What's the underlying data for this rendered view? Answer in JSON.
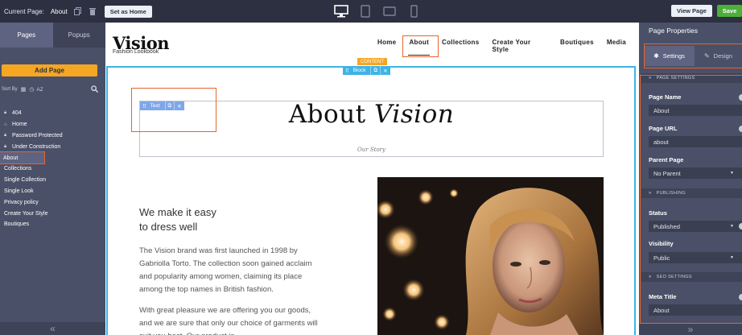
{
  "topbar": {
    "current_page_label": "Current Page:",
    "current_page_value": "About",
    "set_as_home": "Set as Home",
    "view_page": "View Page",
    "save": "Save"
  },
  "left": {
    "tabs": [
      "Pages",
      "Popups"
    ],
    "add_page": "Add Page",
    "sort_by": "Sort By",
    "sort_az": "AZ",
    "pages": [
      {
        "label": "404",
        "icon": "lock-icon"
      },
      {
        "label": "Home",
        "icon": "home-icon"
      },
      {
        "label": "Password Protected",
        "icon": "lock-icon"
      },
      {
        "label": "Under Construction",
        "icon": "lock-icon"
      },
      {
        "label": "About",
        "icon": ""
      },
      {
        "label": "Collections",
        "icon": ""
      },
      {
        "label": "Single Collection",
        "icon": ""
      },
      {
        "label": "Single Look",
        "icon": ""
      },
      {
        "label": "Privacy policy",
        "icon": ""
      },
      {
        "label": "Create Your Style",
        "icon": ""
      },
      {
        "label": "Boutiques",
        "icon": ""
      }
    ]
  },
  "canvas": {
    "logo": "Vision",
    "logo_sub": "Fashion Lookbook",
    "nav": [
      "Home",
      "About",
      "Collections",
      "Create Your Style",
      "Boutiques",
      "Media"
    ],
    "content_tag": "CONTENT",
    "block_tag": "Block",
    "text_tag": "Text",
    "title_plain": "About",
    "title_italic": "Vision",
    "our_story": "Our Story",
    "heading_line1": "We make it easy",
    "heading_line2": "to dress well",
    "para1": "The Vision brand was first launched in 1998 by Gabriolla Torto. The collection soon gained acclaim and popularity among women, claiming its place among the top names in British  fashion.",
    "para2": "With great pleasure we are offering you our goods, and we are sure that only our choice of garments will suit you best. Our product is"
  },
  "right": {
    "title": "Page Properties",
    "tab_settings": "Settings",
    "tab_design": "Design",
    "sec_page_settings": "PAGE SETTINGS",
    "page_name_label": "Page Name",
    "page_name_value": "About",
    "page_url_label": "Page URL",
    "page_url_value": "about",
    "parent_page_label": "Parent Page",
    "parent_page_value": "No Parent",
    "sec_publishing": "PUBLISHING",
    "status_label": "Status",
    "status_value": "Published",
    "visibility_label": "Visibility",
    "visibility_value": "Public",
    "sec_seo": "SEO SETTINGS",
    "meta_title_label": "Meta Title",
    "meta_title_value": "About"
  },
  "colors": {
    "accent_orange": "#f5a623",
    "highlight": "#e8632b",
    "save_green": "#4caf3a",
    "block_blue": "#3db4e5",
    "sidebar": "#4a5068",
    "topbar": "#2c3040"
  }
}
